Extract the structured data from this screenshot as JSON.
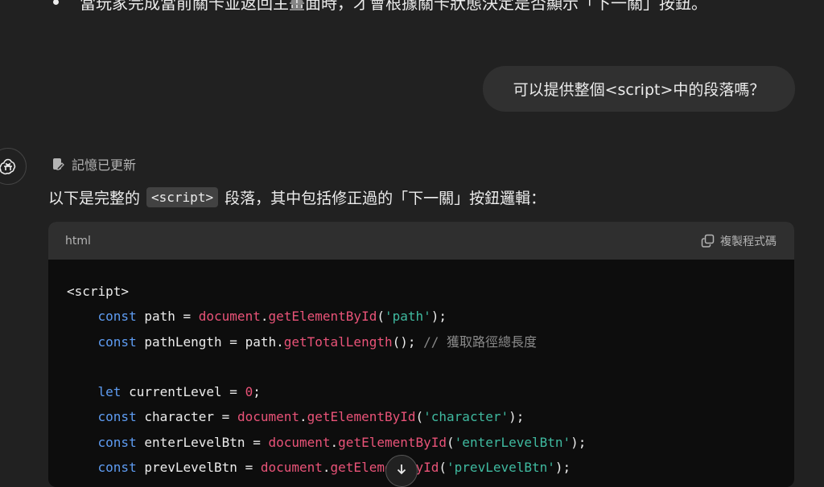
{
  "previous_message": {
    "bullet_text": "當玩家完成當前關卡並返回主畫面時，才會根據關卡狀態決定是否顯示「下一關」按鈕。"
  },
  "user_message": {
    "text": "可以提供整個<script>中的段落嗎？"
  },
  "assistant": {
    "avatar_icon": "openai-logo-icon",
    "memory_status": "記憶已更新",
    "intro_before": "以下是完整的",
    "intro_code": "<script>",
    "intro_after": "段落，其中包括修正過的「下一關」按鈕邏輯："
  },
  "code_block": {
    "language": "html",
    "copy_label": "複製程式碼",
    "lines": [
      [
        {
          "t": "<script>",
          "c": "plain"
        }
      ],
      [
        {
          "t": "    ",
          "c": "plain"
        },
        {
          "t": "const",
          "c": "kw"
        },
        {
          "t": " path = ",
          "c": "plain"
        },
        {
          "t": "document",
          "c": "obj"
        },
        {
          "t": ".",
          "c": "plain"
        },
        {
          "t": "getElementById",
          "c": "fn"
        },
        {
          "t": "(",
          "c": "plain"
        },
        {
          "t": "'path'",
          "c": "str"
        },
        {
          "t": ");",
          "c": "plain"
        }
      ],
      [
        {
          "t": "    ",
          "c": "plain"
        },
        {
          "t": "const",
          "c": "kw"
        },
        {
          "t": " pathLength = path.",
          "c": "plain"
        },
        {
          "t": "getTotalLength",
          "c": "fn"
        },
        {
          "t": "(); ",
          "c": "plain"
        },
        {
          "t": "// 獲取路徑總長度",
          "c": "cm"
        }
      ],
      [
        {
          "t": "",
          "c": "plain"
        }
      ],
      [
        {
          "t": "    ",
          "c": "plain"
        },
        {
          "t": "let",
          "c": "kw"
        },
        {
          "t": " currentLevel = ",
          "c": "plain"
        },
        {
          "t": "0",
          "c": "num"
        },
        {
          "t": ";",
          "c": "plain"
        }
      ],
      [
        {
          "t": "    ",
          "c": "plain"
        },
        {
          "t": "const",
          "c": "kw"
        },
        {
          "t": " character = ",
          "c": "plain"
        },
        {
          "t": "document",
          "c": "obj"
        },
        {
          "t": ".",
          "c": "plain"
        },
        {
          "t": "getElementById",
          "c": "fn"
        },
        {
          "t": "(",
          "c": "plain"
        },
        {
          "t": "'character'",
          "c": "str"
        },
        {
          "t": ");",
          "c": "plain"
        }
      ],
      [
        {
          "t": "    ",
          "c": "plain"
        },
        {
          "t": "const",
          "c": "kw"
        },
        {
          "t": " enterLevelBtn = ",
          "c": "plain"
        },
        {
          "t": "document",
          "c": "obj"
        },
        {
          "t": ".",
          "c": "plain"
        },
        {
          "t": "getElementById",
          "c": "fn"
        },
        {
          "t": "(",
          "c": "plain"
        },
        {
          "t": "'enterLevelBtn'",
          "c": "str"
        },
        {
          "t": ");",
          "c": "plain"
        }
      ],
      [
        {
          "t": "    ",
          "c": "plain"
        },
        {
          "t": "const",
          "c": "kw"
        },
        {
          "t": " prevLevelBtn = ",
          "c": "plain"
        },
        {
          "t": "document",
          "c": "obj"
        },
        {
          "t": ".",
          "c": "plain"
        },
        {
          "t": "getElementById",
          "c": "fn"
        },
        {
          "t": "(",
          "c": "plain"
        },
        {
          "t": "'prevLevelBtn'",
          "c": "str"
        },
        {
          "t": ");",
          "c": "plain"
        }
      ]
    ]
  },
  "scroll_button": {
    "icon": "arrow-down-icon"
  },
  "colors": {
    "background": "#212121",
    "bubble": "#303030",
    "code_bg": "#0d0d0d",
    "code_header": "#2f2f2f",
    "keyword": "#5e9cf2",
    "function": "#e95378",
    "string": "#3fbaa0",
    "comment": "#8a8a8a"
  }
}
